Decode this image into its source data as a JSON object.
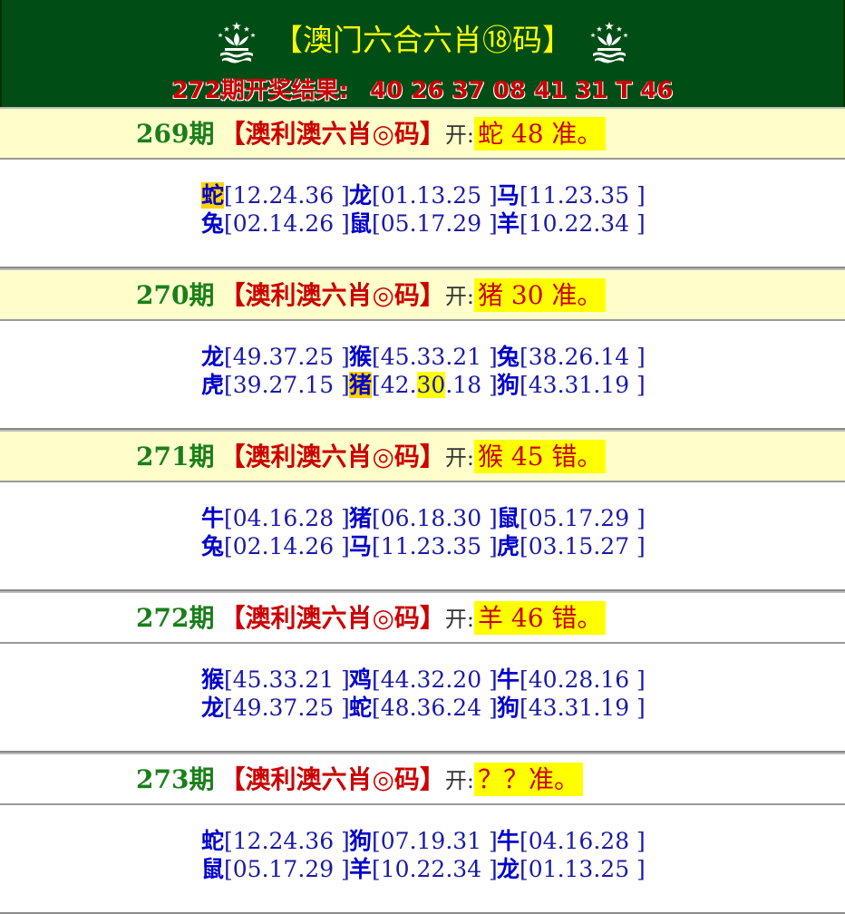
{
  "header": {
    "title_left": "【澳门六合",
    "title_mid": "六肖⑱码",
    "title_right": "】",
    "result_label": "272期开奖结果:",
    "result_numbers": "40 26 37 08 41 31 T 46"
  },
  "colors": {
    "header_bg": "#004d16",
    "period_row_bg": "#ffffcc",
    "answer_bg": "#ffff00",
    "period_green": "#1a7f1a",
    "zodiac_blue": "#0000cc",
    "red": "#cc0000"
  },
  "periods": [
    {
      "period": "269期",
      "bracket": "【澳利澳六肖◎码】",
      "open_label": "开:",
      "answer": "蛇 48 准。",
      "rows": [
        [
          {
            "z": "蛇",
            "n": "[12.24.36 ]"
          },
          {
            "z": "龙",
            "n": "[01.13.25 ]"
          },
          {
            "z": "马",
            "n": "[11.23.35 ]"
          }
        ],
        [
          {
            "z": "兔",
            "n": "[02.14.26 ]"
          },
          {
            "z": "鼠",
            "n": "[05.17.29 ]"
          },
          {
            "z": "羊",
            "n": "[10.22.34 ]"
          }
        ]
      ]
    },
    {
      "period": "270期",
      "bracket": "【澳利澳六肖◎码】",
      "open_label": "开:",
      "answer": "猪 30 准。",
      "rows": [
        [
          {
            "z": "龙",
            "n": "[49.37.25 ]"
          },
          {
            "z": "猴",
            "n": "[45.33.21 ]"
          },
          {
            "z": "兔",
            "n": "[38.26.14 ]"
          }
        ],
        [
          {
            "z": "虎",
            "n": "[39.27.15 ]"
          },
          {
            "z": "猪",
            "n_a": "[42.",
            "n_b": "30",
            "n_c": ".18 ]"
          },
          {
            "z": "狗",
            "n": "[43.31.19 ]"
          }
        ]
      ]
    },
    {
      "period": "271期",
      "bracket": "【澳利澳六肖◎码】",
      "open_label": "开:",
      "answer": "猴 45 错。",
      "rows": [
        [
          {
            "z": "牛",
            "n": "[04.16.28 ]"
          },
          {
            "z": "猪",
            "n": "[06.18.30 ]"
          },
          {
            "z": "鼠",
            "n": "[05.17.29 ]"
          }
        ],
        [
          {
            "z": "兔",
            "n": "[02.14.26 ]"
          },
          {
            "z": "马",
            "n": "[11.23.35 ]"
          },
          {
            "z": "虎",
            "n": "[03.15.27 ]"
          }
        ]
      ]
    },
    {
      "period": "272期",
      "bracket": "【澳利澳六肖◎码】",
      "open_label": "开:",
      "answer": "羊 46 错。",
      "rows": [
        [
          {
            "z": "猴",
            "n": "[45.33.21 ]"
          },
          {
            "z": "鸡",
            "n": "[44.32.20 ]"
          },
          {
            "z": "牛",
            "n": "[40.28.16 ]"
          }
        ],
        [
          {
            "z": "龙",
            "n": "[49.37.25 ]"
          },
          {
            "z": "蛇",
            "n": "[48.36.24 ]"
          },
          {
            "z": "狗",
            "n": "[43.31.19 ]"
          }
        ]
      ]
    },
    {
      "period": "273期",
      "bracket": "【澳利澳六肖◎码】",
      "open_label": "开:",
      "answer": "？？准。",
      "rows": [
        [
          {
            "z": "蛇",
            "n": "[12.24.36 ]"
          },
          {
            "z": "狗",
            "n": "[07.19.31 ]"
          },
          {
            "z": "牛",
            "n": "[04.16.28 ]"
          }
        ],
        [
          {
            "z": "鼠",
            "n": "[05.17.29 ]"
          },
          {
            "z": "羊",
            "n": "[10.22.34 ]"
          },
          {
            "z": "龙",
            "n": "[01.13.25 ]"
          }
        ]
      ]
    }
  ]
}
